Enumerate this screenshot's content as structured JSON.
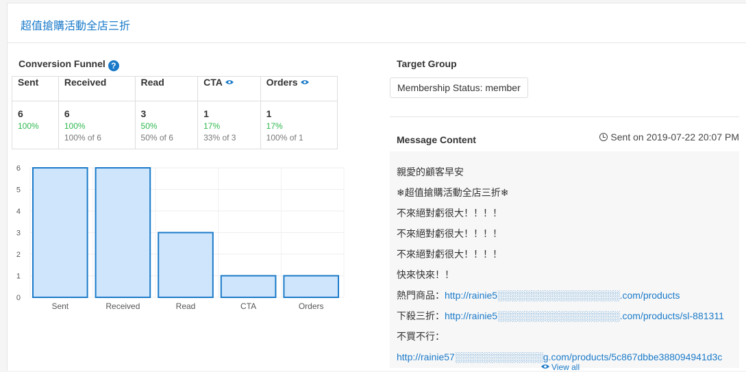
{
  "header": {
    "title": "超值搶購活動全店三折"
  },
  "funnel": {
    "title": "Conversion Funnel",
    "help_icon": "?",
    "columns": [
      {
        "label": "Sent",
        "count": "6",
        "pct": "100%",
        "of": ""
      },
      {
        "label": "Received",
        "count": "6",
        "pct": "100%",
        "of": "100% of 6"
      },
      {
        "label": "Read",
        "count": "3",
        "pct": "50%",
        "of": "50% of 6"
      },
      {
        "label": "CTA",
        "count": "1",
        "pct": "17%",
        "of": "33% of 3"
      },
      {
        "label": "Orders",
        "count": "1",
        "pct": "17%",
        "of": "100% of 1"
      }
    ]
  },
  "chart_data": {
    "type": "bar",
    "categories": [
      "Sent",
      "Received",
      "Read",
      "CTA",
      "Orders"
    ],
    "values": [
      6,
      6,
      3,
      1,
      1
    ],
    "ylim": [
      0,
      6
    ],
    "yticks": [
      "0",
      "1",
      "2",
      "3",
      "4",
      "5",
      "6"
    ],
    "bar_fill": "#cfe5fb",
    "bar_stroke": "#1a7ac9"
  },
  "target": {
    "title": "Target Group",
    "tag": "Membership Status: member"
  },
  "message": {
    "title": "Message Content",
    "sent_on": "Sent on 2019-07-22 20:07 PM",
    "lines": [
      {
        "text": "親愛的顧客早安",
        "link": ""
      },
      {
        "text": "❄超值搶購活動全店三折❄",
        "link": ""
      },
      {
        "text": "不來絕對虧很大！！！！",
        "link": ""
      },
      {
        "text": "不來絕對虧很大！！！！",
        "link": ""
      },
      {
        "text": "不來絕對虧很大！！！！",
        "link": ""
      },
      {
        "text": "快來快來！！",
        "link": ""
      },
      {
        "text": "熱門商品：",
        "link": "http://rainie5░░░░░░░░░░░░░░░░░░.com/products"
      },
      {
        "text": "下殺三折：",
        "link": "http://rainie5░░░░░░░░░░░░░░░░░░.com/products/sl-881311"
      },
      {
        "text": "不買不行：",
        "link": ""
      },
      {
        "text": "",
        "link": "http://rainie57░░░░░░░░░░░░░g.com/products/5c867dbbe388094941d3c"
      }
    ],
    "view_all": "View all"
  }
}
